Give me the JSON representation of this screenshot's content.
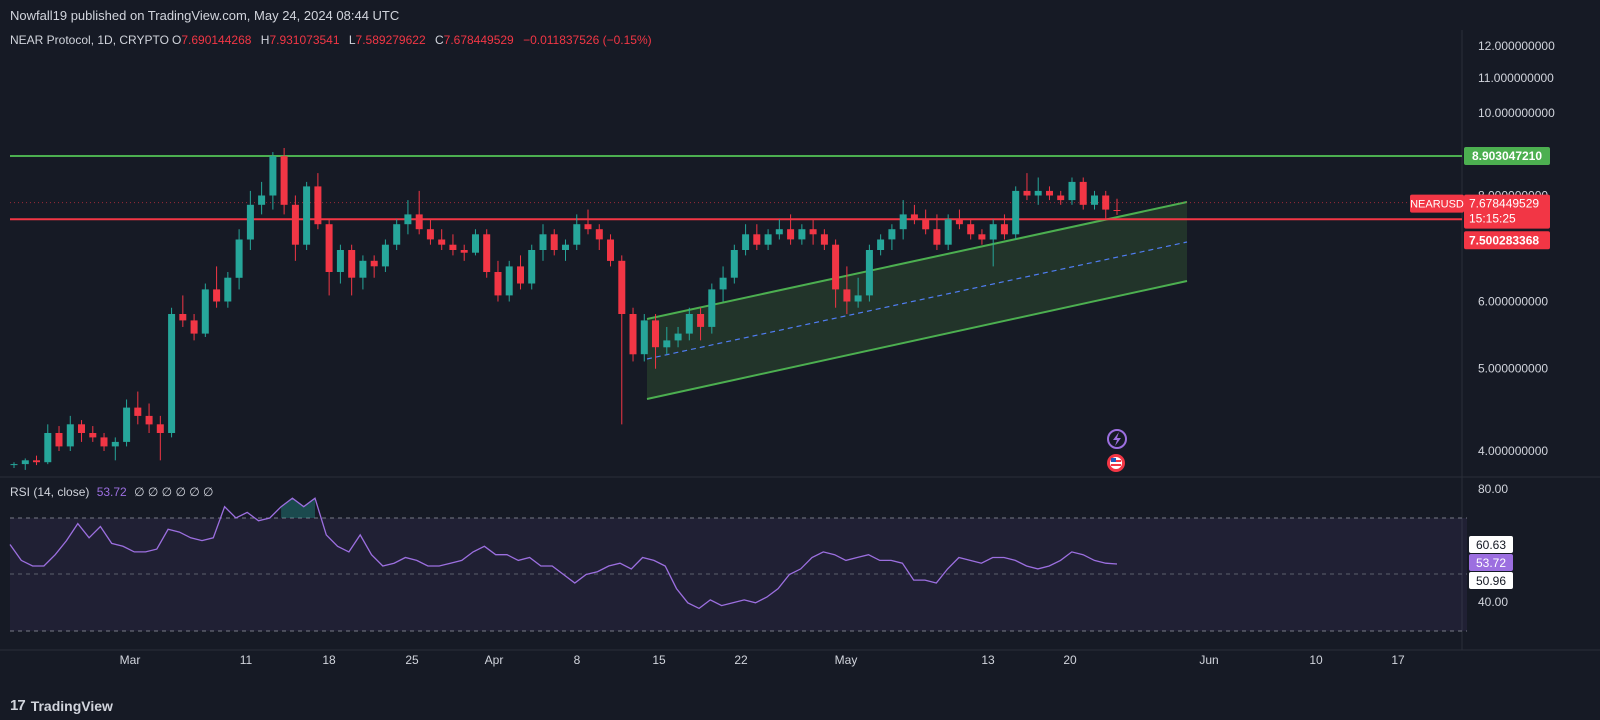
{
  "header": {
    "published_by": "Nowfall19 published on TradingView.com, May 24, 2024 08:44 UTC"
  },
  "legend": {
    "symbol": "NEAR Protocol, 1D, CRYPTO",
    "o_label": "O",
    "o_value": "7.690144268",
    "h_label": "H",
    "h_value": "7.931073541",
    "l_label": "L",
    "l_value": "7.589279622",
    "c_label": "C",
    "c_value": "7.678449529",
    "change": "−0.011837526 (−0.15%)"
  },
  "rsi_legend": {
    "label": "RSI (14, close)",
    "value": "53.72",
    "placeholders": "∅ ∅ ∅ ∅ ∅ ∅"
  },
  "price_axis": {
    "ticks": [
      "12.000000000",
      "11.000000000",
      "10.000000000",
      "8.000000000",
      "6.000000000",
      "5.000000000",
      "4.000000000"
    ],
    "tick_values": [
      12,
      11,
      10,
      8,
      6,
      5,
      4
    ]
  },
  "price_labels": {
    "resistance": "8.903047210",
    "symbol_tag": "NEARUSD",
    "last_price": "7.678449529",
    "countdown": "15:15:25",
    "support": "7.500283368"
  },
  "rsi_axis": {
    "ticks": [
      "80.00",
      "40.00"
    ],
    "upper_label": "60.63",
    "current_label": "53.72",
    "lower_label": "50.96"
  },
  "time_axis": {
    "labels": [
      "Mar",
      "11",
      "18",
      "25",
      "Apr",
      "8",
      "15",
      "22",
      "May",
      "13",
      "20",
      "Jun",
      "10",
      "17"
    ]
  },
  "footer": {
    "brand": "TradingView",
    "brand_mark": "17"
  },
  "colors": {
    "background": "#161a25",
    "up": "#26a69a",
    "down": "#f23645",
    "resistance_line": "#4caf50",
    "support_line": "#f23645",
    "rsi_line": "#9c6fe0",
    "channel_fill": "#2e4a30"
  },
  "icons": [
    "lightning-icon",
    "us-flag-icon"
  ],
  "chart_data": {
    "type": "candlestick",
    "symbol": "NEARUSD",
    "timeframe": "1D",
    "resistance_level": 8.90304721,
    "support_level": 7.500283368,
    "last_close": 7.678449529,
    "candles": [
      [
        3.85,
        3.88,
        3.82,
        3.86
      ],
      [
        3.86,
        3.92,
        3.8,
        3.9
      ],
      [
        3.9,
        3.95,
        3.85,
        3.88
      ],
      [
        3.88,
        4.3,
        3.86,
        4.2
      ],
      [
        4.2,
        4.28,
        4.0,
        4.05
      ],
      [
        4.05,
        4.4,
        4.0,
        4.3
      ],
      [
        4.3,
        4.35,
        4.1,
        4.2
      ],
      [
        4.2,
        4.28,
        4.1,
        4.15
      ],
      [
        4.15,
        4.2,
        4.0,
        4.05
      ],
      [
        4.05,
        4.15,
        3.9,
        4.1
      ],
      [
        4.1,
        4.6,
        4.05,
        4.5
      ],
      [
        4.5,
        4.7,
        4.3,
        4.4
      ],
      [
        4.4,
        4.55,
        4.2,
        4.3
      ],
      [
        4.3,
        4.4,
        3.9,
        4.2
      ],
      [
        4.2,
        5.9,
        4.15,
        5.8
      ],
      [
        5.8,
        6.1,
        5.6,
        5.7
      ],
      [
        5.7,
        5.8,
        5.4,
        5.5
      ],
      [
        5.5,
        6.3,
        5.45,
        6.2
      ],
      [
        6.2,
        6.6,
        5.9,
        6.0
      ],
      [
        6.0,
        6.5,
        5.9,
        6.4
      ],
      [
        6.4,
        7.3,
        6.2,
        7.1
      ],
      [
        7.1,
        8.1,
        6.9,
        7.8
      ],
      [
        7.8,
        8.3,
        7.6,
        8.0
      ],
      [
        8.0,
        9.0,
        7.7,
        8.9
      ],
      [
        8.9,
        9.1,
        7.6,
        7.8
      ],
      [
        7.8,
        8.0,
        6.7,
        7.0
      ],
      [
        7.0,
        8.3,
        6.9,
        8.2
      ],
      [
        8.2,
        8.5,
        7.3,
        7.4
      ],
      [
        7.4,
        7.5,
        6.1,
        6.5
      ],
      [
        6.5,
        7.0,
        6.3,
        6.9
      ],
      [
        6.9,
        7.0,
        6.1,
        6.4
      ],
      [
        6.4,
        6.8,
        6.2,
        6.7
      ],
      [
        6.7,
        6.8,
        6.4,
        6.6
      ],
      [
        6.6,
        7.1,
        6.5,
        7.0
      ],
      [
        7.0,
        7.5,
        6.9,
        7.4
      ],
      [
        7.4,
        7.9,
        7.2,
        7.6
      ],
      [
        7.6,
        8.1,
        7.2,
        7.3
      ],
      [
        7.3,
        7.5,
        7.0,
        7.1
      ],
      [
        7.1,
        7.3,
        6.9,
        7.0
      ],
      [
        7.0,
        7.2,
        6.8,
        6.9
      ],
      [
        6.9,
        7.0,
        6.7,
        6.85
      ],
      [
        6.85,
        7.3,
        6.8,
        7.2
      ],
      [
        7.2,
        7.3,
        6.4,
        6.5
      ],
      [
        6.5,
        6.7,
        6.0,
        6.1
      ],
      [
        6.1,
        6.7,
        6.0,
        6.6
      ],
      [
        6.6,
        6.8,
        6.2,
        6.3
      ],
      [
        6.3,
        7.0,
        6.2,
        6.9
      ],
      [
        6.9,
        7.4,
        6.7,
        7.2
      ],
      [
        7.2,
        7.3,
        6.8,
        6.9
      ],
      [
        6.9,
        7.1,
        6.7,
        7.0
      ],
      [
        7.0,
        7.6,
        6.9,
        7.4
      ],
      [
        7.4,
        7.7,
        7.2,
        7.3
      ],
      [
        7.3,
        7.4,
        6.9,
        7.1
      ],
      [
        7.1,
        7.2,
        6.6,
        6.7
      ],
      [
        6.7,
        6.8,
        4.3,
        5.8
      ],
      [
        5.8,
        5.9,
        5.1,
        5.2
      ],
      [
        5.2,
        5.8,
        5.1,
        5.7
      ],
      [
        5.7,
        5.8,
        5.0,
        5.3
      ],
      [
        5.3,
        5.6,
        5.2,
        5.4
      ],
      [
        5.4,
        5.6,
        5.3,
        5.5
      ],
      [
        5.5,
        5.9,
        5.4,
        5.8
      ],
      [
        5.8,
        5.9,
        5.4,
        5.6
      ],
      [
        5.6,
        6.3,
        5.5,
        6.2
      ],
      [
        6.2,
        6.6,
        6.0,
        6.4
      ],
      [
        6.4,
        7.0,
        6.3,
        6.9
      ],
      [
        6.9,
        7.4,
        6.8,
        7.2
      ],
      [
        7.2,
        7.4,
        6.9,
        7.0
      ],
      [
        7.0,
        7.3,
        6.9,
        7.2
      ],
      [
        7.2,
        7.5,
        7.1,
        7.3
      ],
      [
        7.3,
        7.6,
        7.0,
        7.1
      ],
      [
        7.1,
        7.4,
        7.0,
        7.3
      ],
      [
        7.3,
        7.5,
        7.0,
        7.2
      ],
      [
        7.2,
        7.3,
        6.9,
        7.0
      ],
      [
        7.0,
        7.1,
        5.9,
        6.2
      ],
      [
        6.2,
        6.6,
        5.8,
        6.0
      ],
      [
        6.0,
        6.4,
        5.9,
        6.1
      ],
      [
        6.1,
        7.0,
        6.0,
        6.9
      ],
      [
        6.9,
        7.2,
        6.8,
        7.1
      ],
      [
        7.1,
        7.4,
        6.9,
        7.3
      ],
      [
        7.3,
        7.9,
        7.1,
        7.6
      ],
      [
        7.6,
        7.8,
        7.4,
        7.5
      ],
      [
        7.5,
        7.7,
        7.2,
        7.3
      ],
      [
        7.3,
        7.6,
        6.9,
        7.0
      ],
      [
        7.0,
        7.6,
        6.9,
        7.5
      ],
      [
        7.5,
        7.7,
        7.3,
        7.4
      ],
      [
        7.4,
        7.5,
        7.1,
        7.2
      ],
      [
        7.2,
        7.3,
        7.0,
        7.1
      ],
      [
        7.1,
        7.5,
        6.6,
        7.4
      ],
      [
        7.4,
        7.6,
        7.1,
        7.2
      ],
      [
        7.2,
        8.2,
        7.1,
        8.1
      ],
      [
        8.1,
        8.5,
        7.9,
        8.0
      ],
      [
        8.0,
        8.4,
        7.8,
        8.1
      ],
      [
        8.1,
        8.2,
        7.9,
        8.0
      ],
      [
        8.0,
        8.1,
        7.8,
        7.9
      ],
      [
        7.9,
        8.4,
        7.8,
        8.3
      ],
      [
        8.3,
        8.4,
        7.7,
        7.8
      ],
      [
        7.8,
        8.1,
        7.7,
        8.0
      ],
      [
        8.0,
        8.1,
        7.5,
        7.7
      ],
      [
        7.69,
        7.93,
        7.59,
        7.68
      ]
    ],
    "rsi": [
      60.63,
      55,
      53,
      53,
      57,
      62,
      68,
      63,
      67,
      61,
      60,
      58,
      58,
      59,
      66,
      65,
      63,
      62,
      63,
      74,
      70,
      72,
      69,
      70,
      74,
      77,
      74,
      77,
      64,
      60,
      58,
      64,
      57,
      53,
      54,
      56,
      55,
      53,
      53,
      54,
      55,
      58,
      60,
      57,
      57,
      55,
      56,
      53,
      53,
      50,
      47,
      50,
      51,
      53,
      54,
      52,
      56,
      55,
      53,
      45,
      40,
      38,
      41,
      39,
      40,
      41,
      40,
      42,
      45,
      50,
      52,
      56,
      58,
      57,
      55,
      56,
      57,
      55,
      55,
      54,
      48,
      48,
      47,
      52,
      56,
      55,
      54,
      56,
      56,
      55,
      53,
      52,
      53,
      55,
      58,
      57,
      55,
      54,
      53.72
    ],
    "rsi_levels": [
      70,
      50,
      30
    ]
  }
}
